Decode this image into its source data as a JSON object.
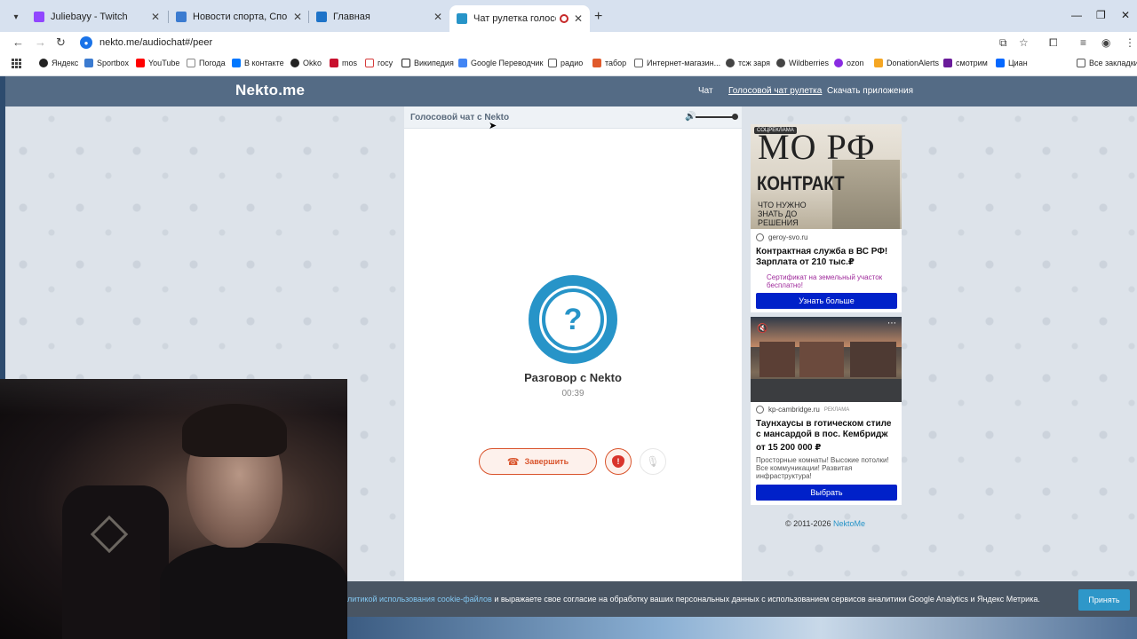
{
  "browser": {
    "tabs": [
      {
        "title": "Juliebayy - Twitch",
        "color": "#9146ff",
        "active": false
      },
      {
        "title": "Новости спорта, Спортивная",
        "color": "#3b7bd0",
        "active": false
      },
      {
        "title": "Главная",
        "color": "#1e73c8",
        "active": false
      },
      {
        "title": "Чат рулетка голосовая —",
        "color": "#2794c8",
        "active": true
      }
    ],
    "url": "nekto.me/audiochat#/peer",
    "bookmarks": [
      {
        "label": "Яндекс",
        "color": "#222"
      },
      {
        "label": "Sportbox",
        "color": "#3b7bd0"
      },
      {
        "label": "YouTube",
        "color": "#ff0000"
      },
      {
        "label": "Погода",
        "color": "#888"
      },
      {
        "label": "В контакте",
        "color": "#0077ff"
      },
      {
        "label": "Okko",
        "color": "#222"
      },
      {
        "label": "mos",
        "color": "#c8102e"
      },
      {
        "label": "госу",
        "color": "#d63b3b"
      },
      {
        "label": "Википедия",
        "color": "#222"
      },
      {
        "label": "Google Переводчик",
        "color": "#4285f4"
      },
      {
        "label": "радио",
        "color": "#555"
      },
      {
        "label": "табор",
        "color": "#e05a2b"
      },
      {
        "label": "Интернет-магазин...",
        "color": "#666"
      },
      {
        "label": "тсж заря",
        "color": "#444"
      },
      {
        "label": "Wildberries",
        "color": "#444"
      },
      {
        "label": "ozon",
        "color": "#8a2be2"
      },
      {
        "label": "DonationAlerts",
        "color": "#f5a623"
      },
      {
        "label": "смотрим",
        "color": "#6a1b9a"
      },
      {
        "label": "Циан",
        "color": "#0468ff"
      }
    ],
    "all_bookmarks": "Все закладки"
  },
  "site": {
    "logo": "Nekto.me",
    "nav": [
      "Чат",
      "Голосовой чат рулетка",
      "Скачать приложения"
    ],
    "panel_title": "Голосовой чат с Nekto",
    "avatar_symbol": "?",
    "talk_title": "Разговор с Nekto",
    "timer": "00:39",
    "end_label": "Завершить",
    "report_symbol": "!",
    "copyright_prefix": "© 2011-2026",
    "copyright_link": "NektoMe"
  },
  "ads": {
    "ad1": {
      "tag": "СОЦРЕКЛАМА",
      "img_title": "МО РФ",
      "img_big": "КОНТРАКТ",
      "img_sub": "ЧТО НУЖНО ЗНАТЬ ДО РЕШЕНИЯ",
      "domain": "geroy-svo.ru",
      "headline": "Контрактная служба в ВС РФ! Зарплата от 210 тыс.₽",
      "promo": "Сертификат на земельный участок бесплатно!",
      "button": "Узнать больше"
    },
    "ad2": {
      "domain": "kp-cambridge.ru",
      "tag": "РЕКЛАМА",
      "headline": "Таунхаусы в готическом стиле с мансардой в пос. Кембридж",
      "price": "от 15 200 000 ₽",
      "desc": "Просторные комнаты! Высокие потолки! Все коммуникации! Развитая инфраструктура!",
      "button": "Выбрать"
    }
  },
  "cookie": {
    "link": "литикой использования cookie-файлов",
    "text": " и выражаете свое согласие на обработку ваших персональных данных с использованием сервисов аналитики Google Analytics и Яндекс Метрика.",
    "accept": "Принять"
  }
}
